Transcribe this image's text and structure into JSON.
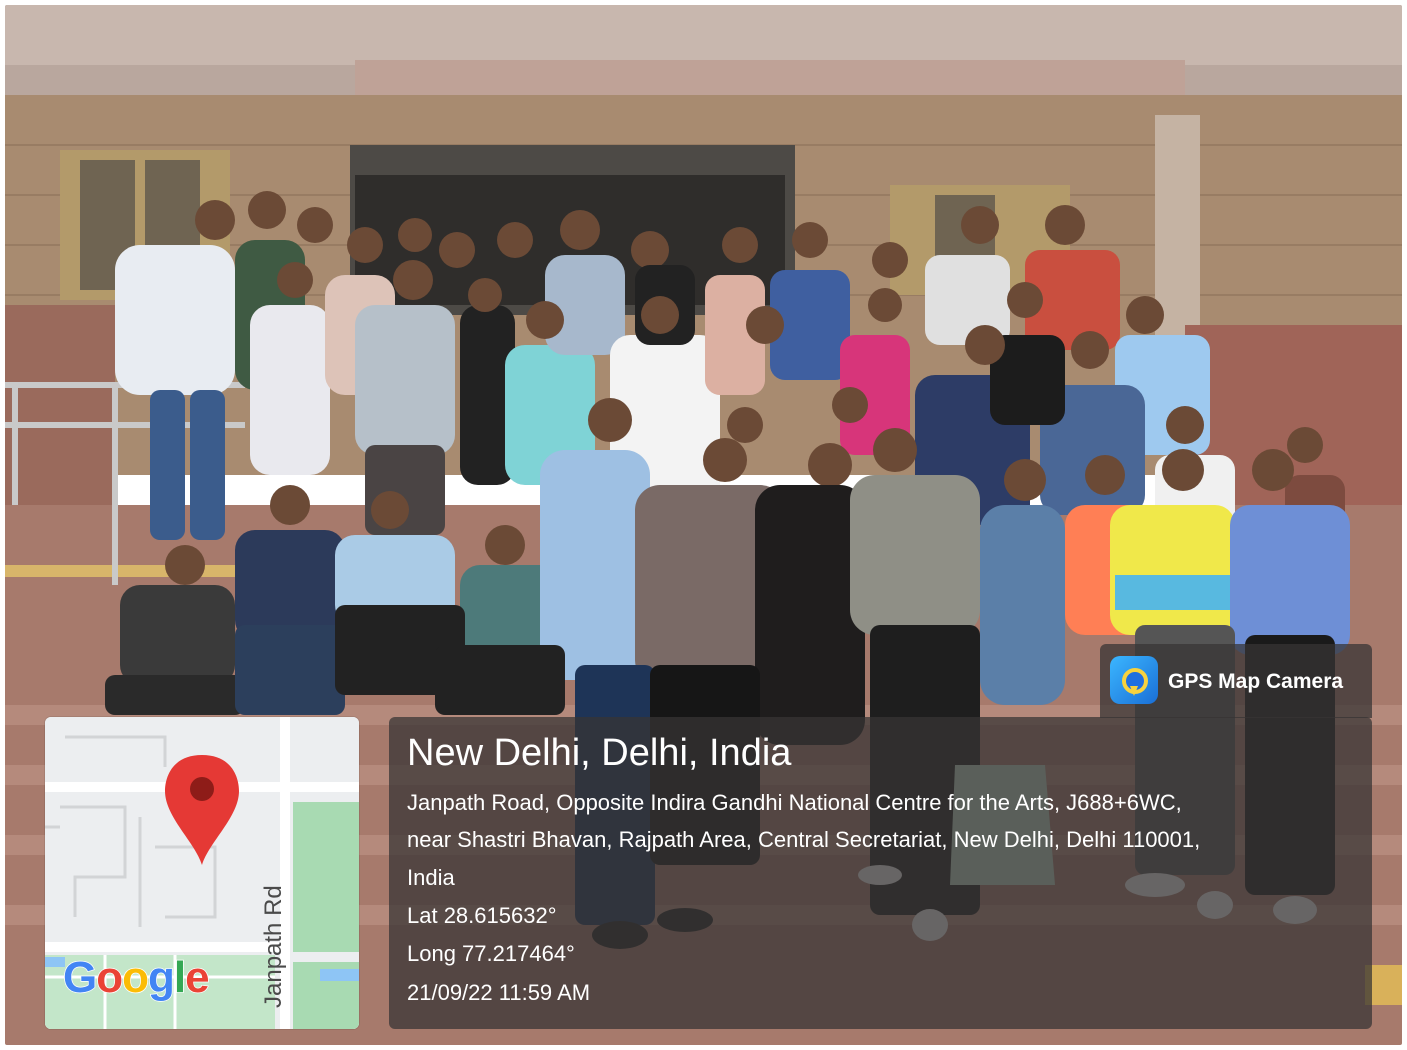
{
  "photo": {
    "description_icon": "group-photo",
    "colors": {
      "sky_ceiling": "#b7a39a",
      "wall": "#a7876a",
      "steps": "#b07a6b"
    }
  },
  "map": {
    "road_label": "Janpath Rd",
    "logo": "Google",
    "pin_color": "#E53935",
    "green_area_color": "#a8dab2",
    "water_color": "#8ec5f5"
  },
  "brand": {
    "label": "GPS Map Camera",
    "icon": "camera-pin-icon"
  },
  "location": {
    "title": "New Delhi, Delhi, India",
    "address_line1": "Janpath Road, Opposite Indira Gandhi National Centre for the Arts, J688+6WC,",
    "address_line2": "near Shastri Bhavan, Rajpath Area, Central Secretariat, New Delhi, Delhi 110001,",
    "address_line3": "India",
    "lat": "Lat 28.615632°",
    "long": "Long 77.217464°",
    "datetime": "21/09/22 11:59 AM"
  }
}
